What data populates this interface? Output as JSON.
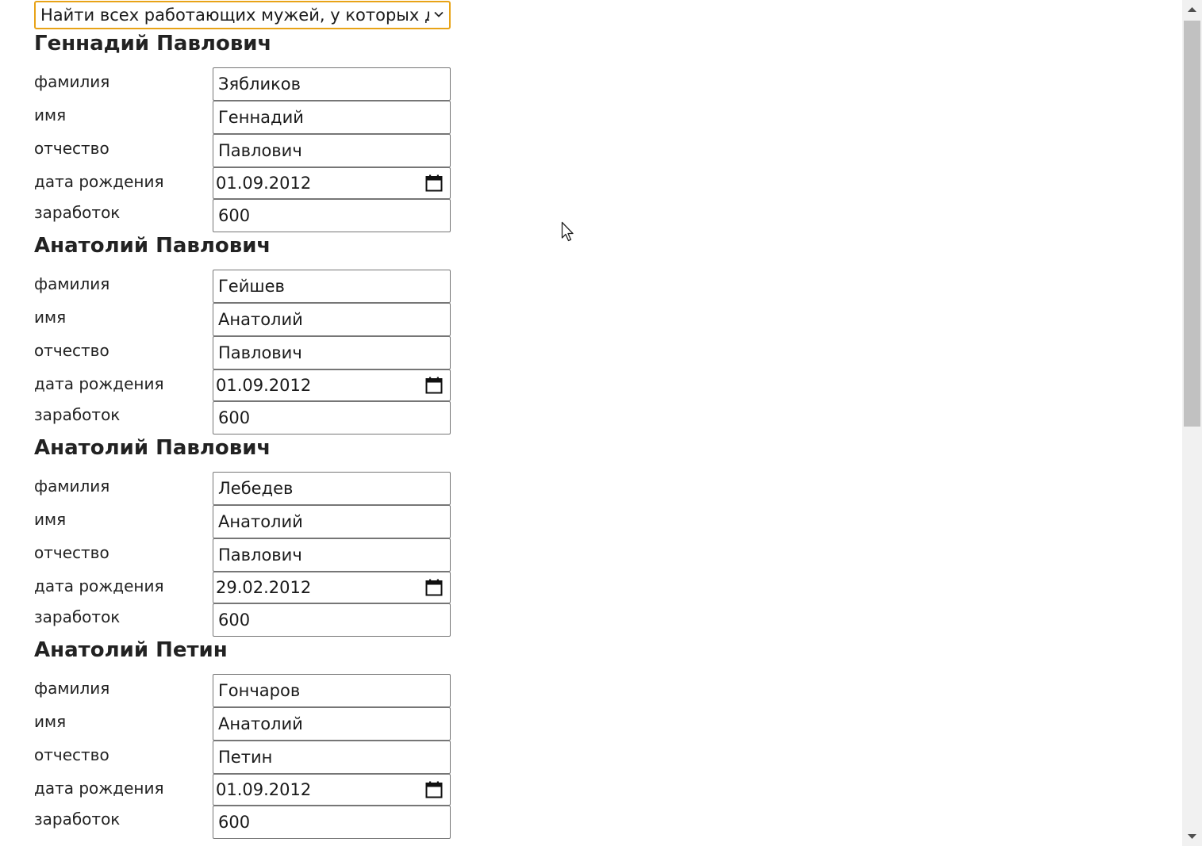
{
  "query": {
    "selected": "Найти всех работающих мужей, у которых д"
  },
  "labels": {
    "surname": "фамилия",
    "first_name": "имя",
    "patronymic": "отчество",
    "birth_date": "дата рождения",
    "salary": "заработок"
  },
  "persons": [
    {
      "title": "Геннадий Павлович",
      "surname": "Зябликов",
      "first_name": "Геннадий",
      "patronymic": "Павлович",
      "birth_date": "01.09.2012",
      "salary": "600"
    },
    {
      "title": "Анатолий Павлович",
      "surname": "Гейшев",
      "first_name": "Анатолий",
      "patronymic": "Павлович",
      "birth_date": "01.09.2012",
      "salary": "600"
    },
    {
      "title": "Анатолий Павлович",
      "surname": "Лебедев",
      "first_name": "Анатолий",
      "patronymic": "Павлович",
      "birth_date": "29.02.2012",
      "salary": "600"
    },
    {
      "title": "Анатолий Петин",
      "surname": "Гончаров",
      "first_name": "Анатолий",
      "patronymic": "Петин",
      "birth_date": "01.09.2012",
      "salary": "600"
    }
  ],
  "icons": {
    "select_arrow": "chevron-down-icon",
    "date_picker": "calendar-icon",
    "scroll_up": "scroll-up-arrow-icon",
    "scroll_down": "scroll-down-arrow-icon",
    "pointer": "mouse-cursor-icon"
  },
  "colors": {
    "select_focus_border": "#e8a317",
    "input_border": "#767676",
    "scroll_thumb": "#c1c1c1"
  }
}
